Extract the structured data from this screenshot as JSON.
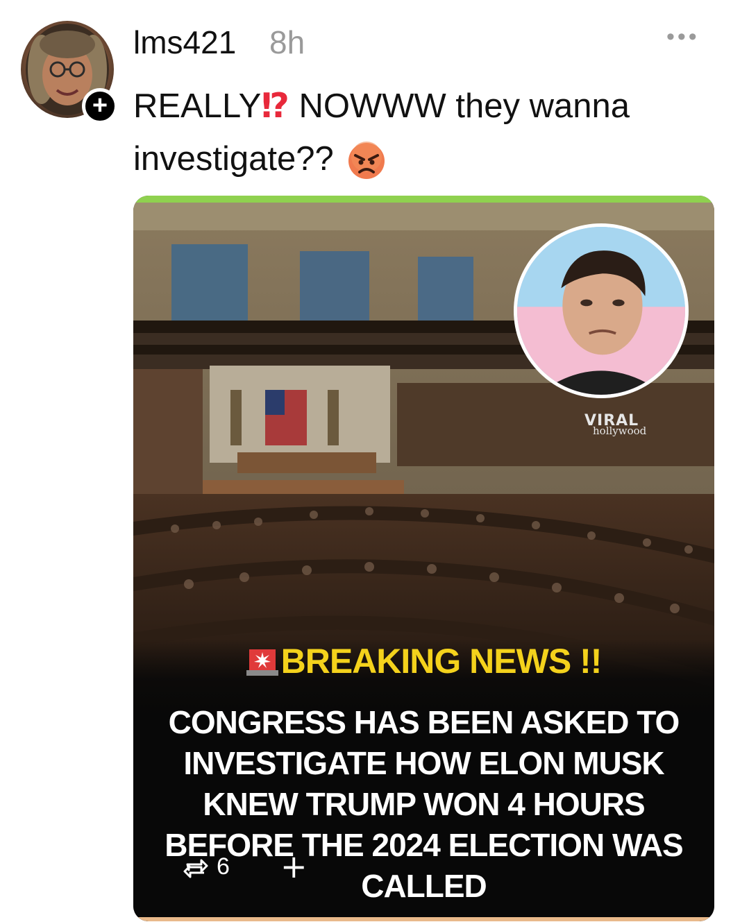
{
  "post": {
    "username": "lms421",
    "timestamp": "8h",
    "more_label": "•••",
    "follow_label": "+",
    "text_part1": "REALLY",
    "text_emoji": "⁉",
    "text_part2": " NOWWW they wanna investigate??",
    "text_emoji_2": "angry-face-icon"
  },
  "media": {
    "watermark": "VIRAL",
    "watermark_sub": "hollywood",
    "breaking_label": "BREAKING NEWS !!",
    "headline": "CONGRESS HAS BEEN ASKED TO INVESTIGATE HOW ELON MUSK KNEW TRUMP WON 4 HOURS BEFORE THE 2024 ELECTION WAS CALLED"
  },
  "actions": {
    "repost_icon": "repost-icon",
    "repost_count": "6",
    "add_label": "+"
  },
  "colors": {
    "breaking_yellow": "#f4d21c",
    "top_strip": "#8fd14f",
    "emoji_red": "#e8293b"
  }
}
